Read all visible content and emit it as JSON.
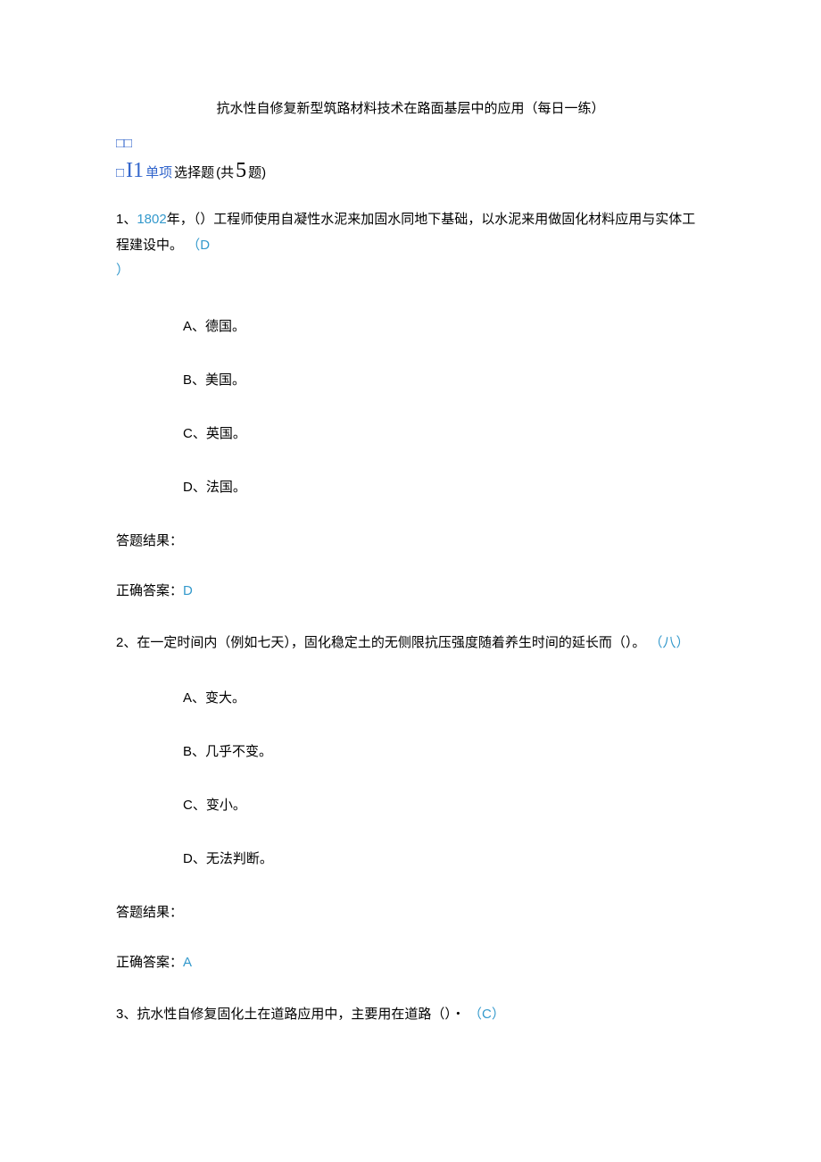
{
  "title": "抗水性自修复新型筑路材料技术在路面基层中的应用（每日一练）",
  "symbols": "□□",
  "section": {
    "prefix_box": "□",
    "i1": "I1",
    "label_blue": "单项",
    "label_black_1": "选择题",
    "paren_open": "  (共",
    "count_num": "5",
    "paren_close": "题)"
  },
  "q1": {
    "stem_pre_num": "1、",
    "stem_num": "1802",
    "stem_after_num": "年，（）工程师使用自凝性水泥来加固水同地下基础，以水泥来用做固化材料应用与实体工程建设中。",
    "stem_mark": "（D",
    "stem_hang": "）",
    "options": {
      "a": "A、德国。",
      "b": "B、美国。",
      "c": "C、英国。",
      "d": "D、法国。"
    },
    "result_label": "答题结果：",
    "correct_prefix": "正确答案：",
    "correct_letter": "D"
  },
  "q2": {
    "stem_pre": "2、在一定时间内（例如七天），固化稳定土的无侧限抗压强度随着养生时间的延长而（）。",
    "stem_mark": "（八）",
    "options": {
      "a": "A、变大。",
      "b": "B、几乎不变。",
      "c": "C、变小。",
      "d": "D、无法判断。"
    },
    "result_label": "答题结果：",
    "correct_prefix": "正确答案：",
    "correct_letter": "A"
  },
  "q3": {
    "stem_pre": "3、抗水性自修复固化土在道路应用中，主要用在道路（）・",
    "stem_mark": "（C）"
  }
}
